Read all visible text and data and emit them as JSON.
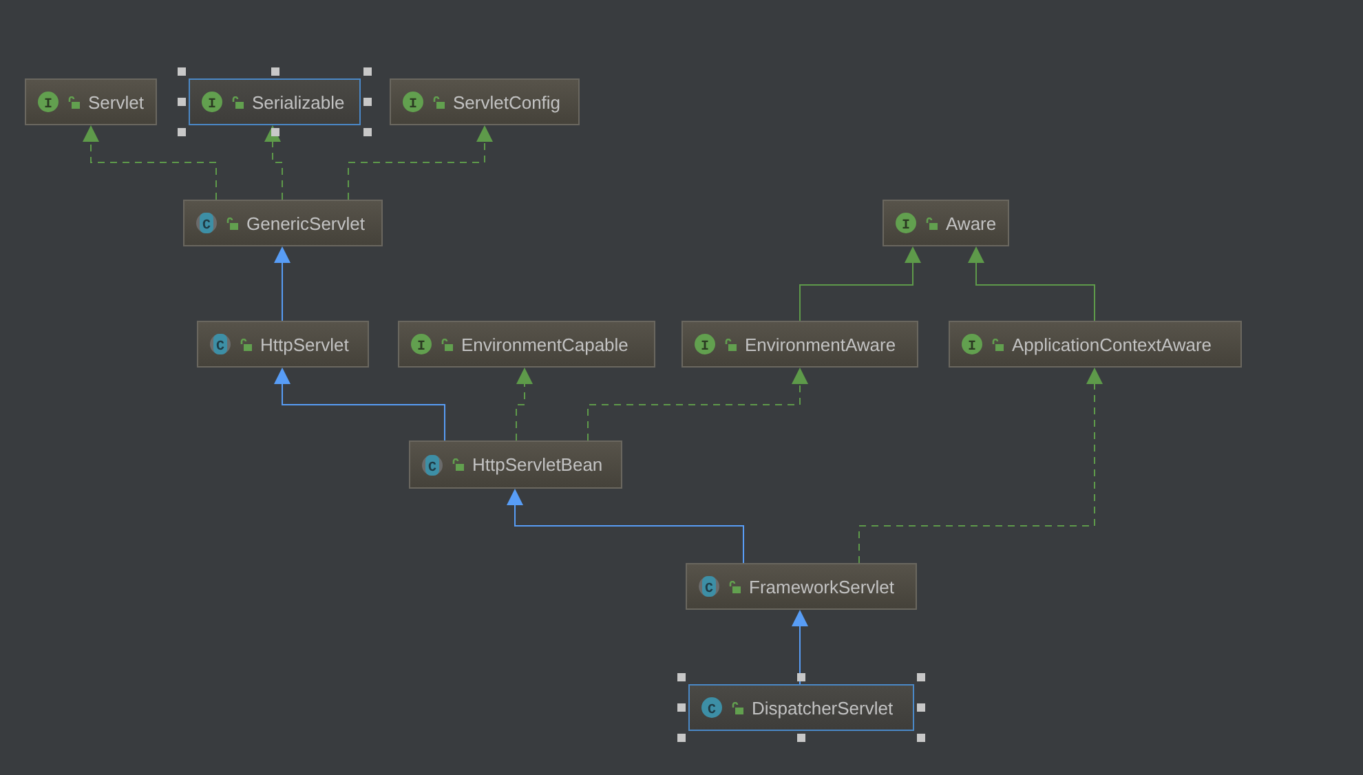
{
  "nodes": [
    {
      "name": "Servlet",
      "kind": "interface",
      "icon_letter": "I",
      "selected": false
    },
    {
      "name": "Serializable",
      "kind": "interface",
      "icon_letter": "I",
      "selected": true
    },
    {
      "name": "ServletConfig",
      "kind": "interface",
      "icon_letter": "I",
      "selected": false
    },
    {
      "name": "GenericServlet",
      "kind": "abstract-class",
      "icon_letter": "C",
      "selected": false
    },
    {
      "name": "Aware",
      "kind": "interface",
      "icon_letter": "I",
      "selected": false
    },
    {
      "name": "HttpServlet",
      "kind": "abstract-class",
      "icon_letter": "C",
      "selected": false
    },
    {
      "name": "EnvironmentCapable",
      "kind": "interface",
      "icon_letter": "I",
      "selected": false
    },
    {
      "name": "EnvironmentAware",
      "kind": "interface",
      "icon_letter": "I",
      "selected": false
    },
    {
      "name": "ApplicationContextAware",
      "kind": "interface",
      "icon_letter": "I",
      "selected": false
    },
    {
      "name": "HttpServletBean",
      "kind": "abstract-class",
      "icon_letter": "C",
      "selected": false
    },
    {
      "name": "FrameworkServlet",
      "kind": "abstract-class",
      "icon_letter": "C",
      "selected": false
    },
    {
      "name": "DispatcherServlet",
      "kind": "class",
      "icon_letter": "C",
      "selected": true
    }
  ],
  "edges": [
    {
      "kind": "implements"
    },
    {
      "kind": "implements"
    },
    {
      "kind": "implements"
    },
    {
      "kind": "extends"
    },
    {
      "kind": "interface-extends"
    },
    {
      "kind": "interface-extends"
    },
    {
      "kind": "extends"
    },
    {
      "kind": "implements"
    },
    {
      "kind": "implements"
    },
    {
      "kind": "extends"
    },
    {
      "kind": "implements"
    },
    {
      "kind": "extends"
    }
  ]
}
